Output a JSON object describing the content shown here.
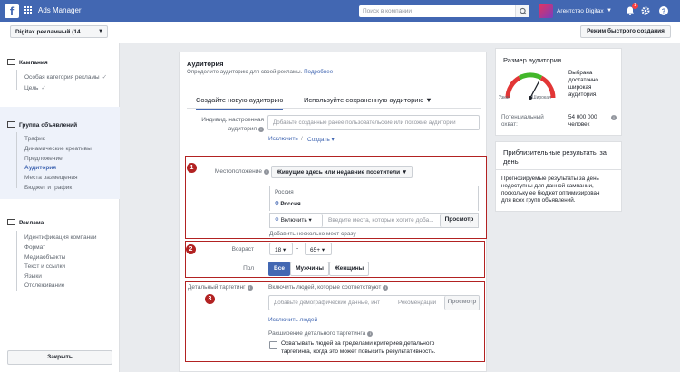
{
  "topbar": {
    "app_title": "Ads Manager",
    "search_placeholder": "Поиск в компании",
    "account_name": "Агентство Digitax",
    "notification_count": "1"
  },
  "subbar": {
    "account_selector": "Digitax рекламный (14...",
    "quick_create": "Режим быстрого создания"
  },
  "sidebar": {
    "campaign": {
      "title": "Кампания",
      "items": [
        "Особая категория рекламы",
        "Цель"
      ]
    },
    "adset": {
      "title": "Группа объявлений",
      "items": [
        "Трафик",
        "Динамические креативы",
        "Предложение",
        "Аудитория",
        "Места размещения",
        "Бюджет и график"
      ],
      "active_index": 3
    },
    "ad": {
      "title": "Реклама",
      "items": [
        "Идентификация компании",
        "Формат",
        "Медиаобъекты",
        "Текст и ссылки",
        "Языки",
        "Отслеживание"
      ]
    },
    "close_label": "Закрыть"
  },
  "audience": {
    "title": "Аудитория",
    "subtitle": "Определите аудиторию для своей рекламы.",
    "more_link": "Подробнее",
    "tab_new": "Создайте новую аудиторию",
    "tab_saved": "Используйте сохраненную аудиторию",
    "custom_label_1": "Индивид. настроенная",
    "custom_label_2": "аудитория",
    "custom_placeholder": "Добавьте созданные ранее пользовательские или похожие аудитории",
    "exclude": "Исключить",
    "create": "Создать",
    "location_label": "Местоположение",
    "location_dropdown": "Живущие здесь или недавние посетители",
    "location_country": "Россия",
    "location_selected": "Россия",
    "include_dropdown": "Включить",
    "location_placeholder": "Введите места, которые хотите доба...",
    "browse": "Просмотр",
    "add_multiple": "Добавить несколько мест сразу",
    "age_label": "Возраст",
    "age_from": "18",
    "age_to": "65+",
    "age_dash": "-",
    "gender_label": "Пол",
    "gender_options": [
      "Все",
      "Мужчины",
      "Женщины"
    ],
    "targeting_label": "Детальный таргетинг",
    "targeting_include": "Включить людей, которые соответствуют",
    "targeting_placeholder": "Добавьте демографические данные, инт",
    "recommendations": "Рекомендации",
    "exclude_people": "Исключить людей",
    "expansion_title": "Расширение детального таргетинга",
    "expansion_text_1": "Охватывать людей за пределами критериев детального",
    "expansion_text_2": "таргетинга, когда это может повысить результативность.",
    "markers": [
      "1",
      "2",
      "3"
    ]
  },
  "audience_size": {
    "title": "Размер аудитории",
    "desc": [
      "Выбрана",
      "достаточно",
      "широкая",
      "аудитория."
    ],
    "narrow": "Узкая",
    "broad": "Широкая",
    "reach_label_1": "Потенциальный",
    "reach_label_2": "охват:",
    "reach_value": "54 000 000",
    "reach_unit": "человек"
  },
  "estimated_results": {
    "title_1": "Приблизительные результаты за",
    "title_2": "день",
    "text": [
      "Прогнозируемые результаты за день",
      "недоступны для данной кампании,",
      "поскольку ее бюджет оптимизирован",
      "для всех групп объявлений."
    ]
  },
  "colors": {
    "brand": "#4267b2",
    "highlight": "#b22222",
    "gauge_green": "#42b72a",
    "gauge_red": "#e23636"
  }
}
